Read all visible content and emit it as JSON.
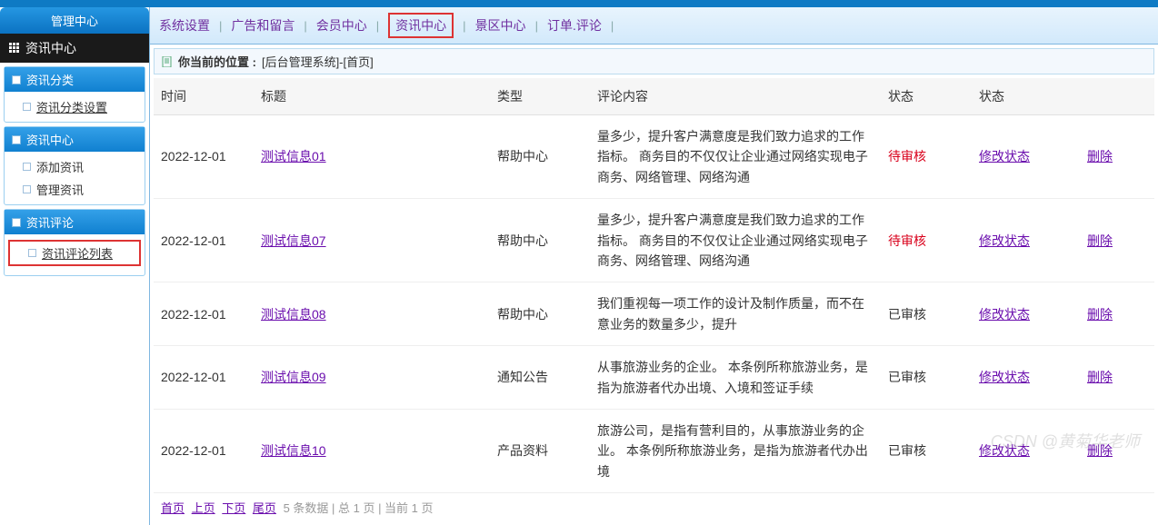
{
  "sidebar": {
    "title": "管理中心",
    "group_label": "资讯中心",
    "sections": [
      {
        "head": "资讯分类",
        "items": [
          {
            "label": "资讯分类设置",
            "underline": true
          }
        ]
      },
      {
        "head": "资讯中心",
        "items": [
          {
            "label": "添加资讯"
          },
          {
            "label": "管理资讯"
          }
        ]
      },
      {
        "head": "资讯评论",
        "items": [
          {
            "label": "资讯评论列表",
            "underline": true,
            "highlight": true
          }
        ]
      }
    ]
  },
  "topnav": {
    "items": [
      "系统设置",
      "广告和留言",
      "会员中心",
      "资讯中心",
      "景区中心",
      "订单.评论"
    ],
    "highlight_index": 3
  },
  "breadcrumb": {
    "prefix": "你当前的位置 :",
    "path": "[后台管理系统]-[首页]"
  },
  "table": {
    "headers": [
      "时间",
      "标题",
      "类型",
      "评论内容",
      "状态",
      "状态"
    ],
    "rows": [
      {
        "time": "2022-12-01",
        "title": "测试信息01",
        "type": "帮助中心",
        "content": "量多少，提升客户满意度是我们致力追求的工作指标。 商务目的不仅仅让企业通过网络实现电子商务、网络管理、网络沟通",
        "status": "待审核",
        "status_red": true
      },
      {
        "time": "2022-12-01",
        "title": "测试信息07",
        "type": "帮助中心",
        "content": "量多少，提升客户满意度是我们致力追求的工作指标。 商务目的不仅仅让企业通过网络实现电子商务、网络管理、网络沟通",
        "status": "待审核",
        "status_red": true
      },
      {
        "time": "2022-12-01",
        "title": "测试信息08",
        "type": "帮助中心",
        "content": "我们重视每一项工作的设计及制作质量，而不在意业务的数量多少，提升",
        "status": "已审核",
        "status_red": false
      },
      {
        "time": "2022-12-01",
        "title": "测试信息09",
        "type": "通知公告",
        "content": "从事旅游业务的企业。 本条例所称旅游业务，是指为旅游者代办出境、入境和签证手续",
        "status": "已审核",
        "status_red": false
      },
      {
        "time": "2022-12-01",
        "title": "测试信息10",
        "type": "产品资料",
        "content": "旅游公司，是指有营利目的，从事旅游业务的企业。 本条例所称旅游业务，是指为旅游者代办出境",
        "status": "已审核",
        "status_red": false
      }
    ],
    "actions": {
      "edit": "修改状态",
      "delete": "删除"
    }
  },
  "pager": {
    "links": [
      "首页",
      "上页",
      "下页",
      "尾页"
    ],
    "info": "5 条数据 | 总 1 页 | 当前 1 页"
  },
  "watermark": "CSDN @黄菊华老师"
}
